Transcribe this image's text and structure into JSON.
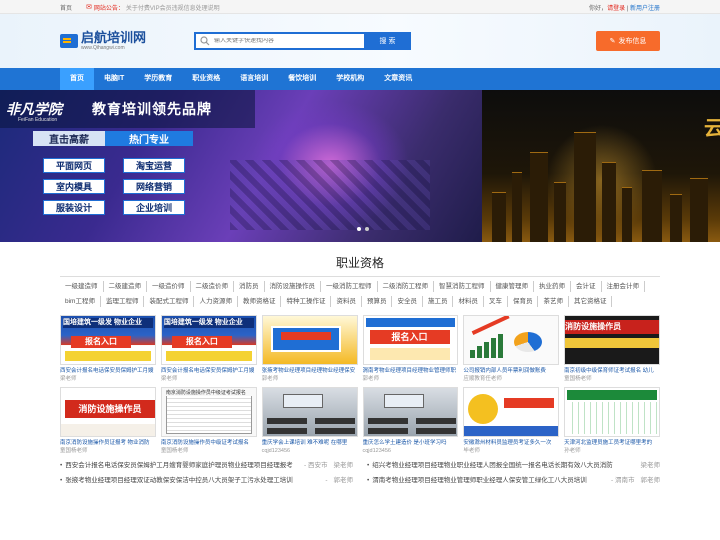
{
  "topbar": {
    "home": "首页",
    "notice_label": "网站公告：",
    "notice_text": "关于付费VIP会员违规信息处理说明",
    "greeting": "你好，",
    "login": "请登录",
    "separator": " | ",
    "register": "新用户注册"
  },
  "header": {
    "logo_cn": "启航培训网",
    "logo_en": "www.Qihangwi.com",
    "search_placeholder": "输入关键字快速找内容",
    "search_button": "搜 索",
    "publish_button": "发布信息"
  },
  "nav": [
    {
      "label": "首页",
      "active": true
    },
    {
      "label": "电脑IT"
    },
    {
      "label": "学历教育"
    },
    {
      "label": "职业资格"
    },
    {
      "label": "语言培训"
    },
    {
      "label": "餐饮培训"
    },
    {
      "label": "学校机构"
    },
    {
      "label": "文章资讯"
    }
  ],
  "banner": {
    "brand_cn": "非凡学院",
    "brand_en": "FeiFan Education",
    "slogan": "教育培训领先品牌",
    "tab1": "直击高薪",
    "tab2": "热门专业",
    "courses": [
      "平面网页",
      "淘宝运营",
      "室内模具",
      "网络营销",
      "服装设计",
      "企业培训"
    ],
    "right_text": "云"
  },
  "section": {
    "title": "职业资格",
    "tags": [
      "一级建造师",
      "二级建造师",
      "一级造价师",
      "二级造价师",
      "消防员",
      "消防设施操作员",
      "一级消防工程师",
      "二级消防工程师",
      "智慧消防工程师",
      "健康管理师",
      "执业药师",
      "会计证",
      "注册会计师",
      "bim工程师",
      "监理工程师",
      "装配式工程师",
      "人力资源师",
      "教师资格证",
      "特种工操作证",
      "资料员",
      "预算员",
      "安全员",
      "施工员",
      "材料员",
      "叉车",
      "保育员",
      "茶艺师",
      "其它资格证"
    ],
    "thumbs": [
      {
        "caption": "西安会计报名电话保安员保姆护工月嫂",
        "author": "梁老师",
        "style": "poster",
        "top": "国培建筑一级发 物业企业",
        "mid": "报名入口"
      },
      {
        "caption": "西安会计报名电话保安员保姆护工月嫂",
        "author": "梁老师",
        "style": "poster",
        "top": "国培建筑一级发 物业企业",
        "mid": "报名入口"
      },
      {
        "caption": "张掖考物业经理项目经理物业经理保安",
        "author": "郭老师",
        "style": "gold"
      },
      {
        "caption": "渭南考物业经理项目经理物业管理师职",
        "author": "郭老师",
        "style": "white",
        "mid": "报名入口"
      },
      {
        "caption": "公司报销内部人员年票利润做账费",
        "author": "应顺教育任老师",
        "style": "chart"
      },
      {
        "caption": "南京初级中级保育师证考试报名 幼儿",
        "author": "童国杨老师",
        "style": "fire",
        "mid": "消防设施操作员"
      },
      {
        "caption": "南京消防设施操作员证报考 物业消防",
        "author": "童国杨老师",
        "style": "fire2",
        "mid": "消防设施操作员"
      },
      {
        "caption": "南京消防设施操作员中级证考试报名",
        "author": "童国杨老师",
        "style": "doc",
        "mid": "南京消防设施操作员中级证考试报名"
      },
      {
        "caption": "重庆学会上课培训 难不难呢 在哪里",
        "author": "cqjd123456",
        "style": "class"
      },
      {
        "caption": "重庆怎么学土建造价 是小班学习吗",
        "author": "cqjd123456",
        "style": "class"
      },
      {
        "caption": "安徽滁州材料员监理员考证多久一次",
        "author": "毕老师",
        "style": "report"
      },
      {
        "caption": "天津河北监理员施工员考证哪里考的",
        "author": "孙老师",
        "style": "green"
      }
    ],
    "list": [
      {
        "text": "西安会计报名电话保安员保姆护工月嫂育婴师家庭护理员物业经理项目经理报考",
        "loc": "- 西安市",
        "author": "梁老师"
      },
      {
        "text": "绍兴考物业经理项目经理物业职业经理人团报全国统一报名电话长期有效八大员消防",
        "loc": "",
        "author": "梁老师"
      },
      {
        "text": "张掖考物业经理项目经理双证动教保安保洁中控员八大员架子工污水处理工培训",
        "loc": "-",
        "author": "郭老师"
      },
      {
        "text": "渭南考物业经理项目经理物业管理师职业经理人保安管工绿化工八大员培训",
        "loc": "- 渭南市",
        "author": "郭老师"
      }
    ]
  }
}
